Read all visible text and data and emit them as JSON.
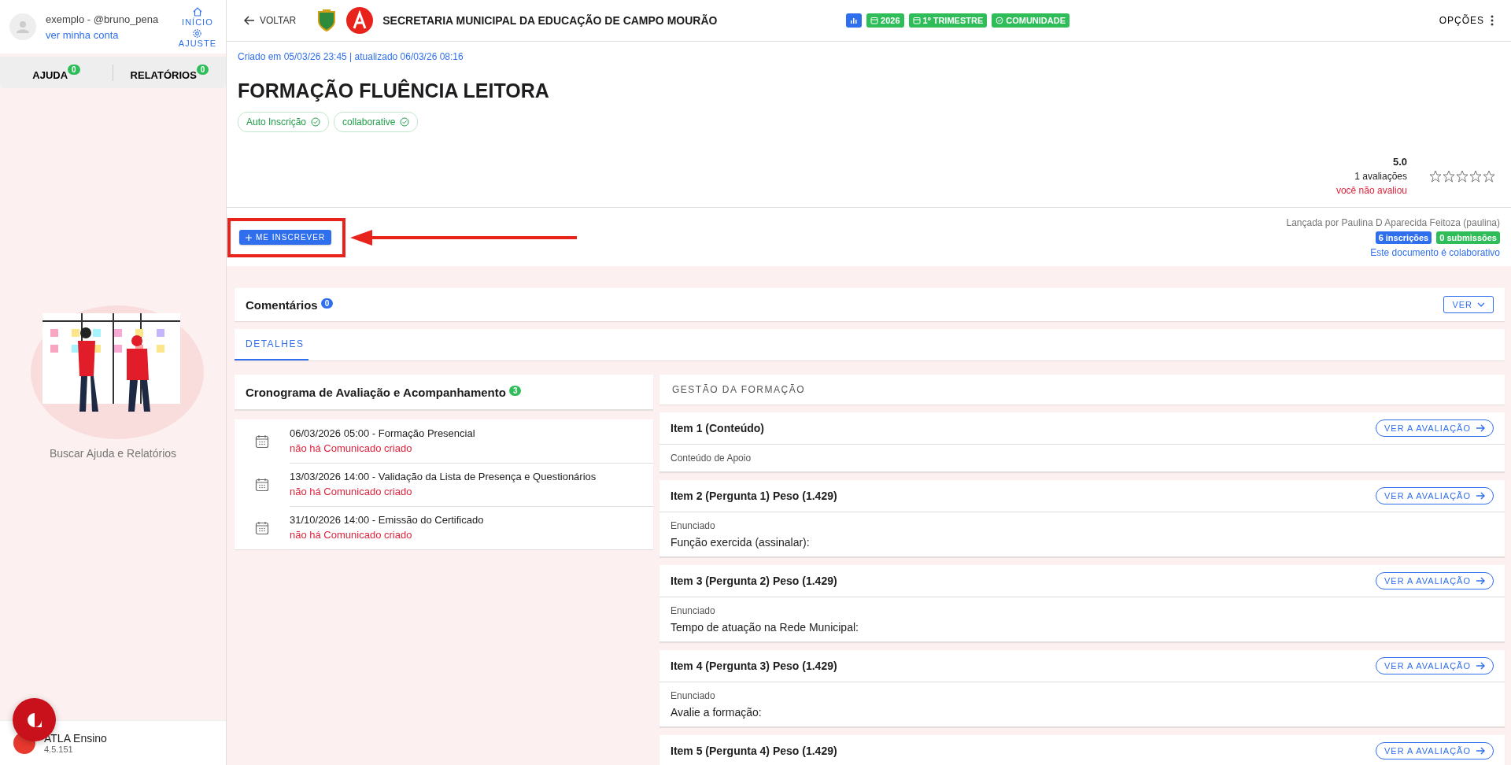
{
  "sidebar": {
    "user_name": "exemplo - @bruno_pena",
    "account_link": "ver minha conta",
    "nav": [
      {
        "kind": "home",
        "label": "INÍCIO"
      },
      {
        "kind": "settings",
        "label": "AJUSTE"
      }
    ],
    "tabs": [
      {
        "label": "AJUDA",
        "count": "0"
      },
      {
        "label": "RELATÓRIOS",
        "count": "0"
      }
    ],
    "empty_text": "Buscar Ajuda e Relatórios",
    "footer": {
      "app_name": "ATLA Ensino",
      "version": "4.5.151"
    }
  },
  "topbar": {
    "back": "VOLTAR",
    "title": "SECRETARIA MUNICIPAL DA EDUCAÇÃO DE CAMPO MOURÃO",
    "badges": [
      {
        "kind": "chart",
        "color": "#2f6fed"
      },
      {
        "kind": "calendar",
        "label": "2026",
        "color": "#2ebd59"
      },
      {
        "kind": "calendar",
        "label": "1º TRIMESTRE",
        "color": "#2ebd59"
      },
      {
        "kind": "check",
        "label": "COMUNIDADE",
        "color": "#2ebd59"
      }
    ],
    "options": "OPÇÕES"
  },
  "document": {
    "meta": "Criado em 05/03/26 23:45 | atualizado 06/03/26 08:16",
    "title": "FORMAÇÃO FLUÊNCIA LEITORA",
    "tags": [
      "Auto Inscrição",
      "collaborative"
    ],
    "rating": {
      "score": "5.0",
      "count": "1 avaliações",
      "note": "você não avaliou",
      "stars": 0
    },
    "enroll_button": "ME INSCREVER",
    "author": "Lançada por Paulina D Aparecida Feitoza (paulina)",
    "stats": [
      {
        "label": "6 inscrições",
        "color": "#2f6fed"
      },
      {
        "label": "0 submissões",
        "color": "#2ebd59"
      }
    ],
    "collab_link": "Este documento é colaborativo"
  },
  "comments": {
    "title": "Comentários",
    "count": "0",
    "button": "VER"
  },
  "tabs": [
    {
      "label": "DETALHES",
      "selected": true
    }
  ],
  "schedule": {
    "title": "Cronograma de Avaliação e Acompanhamento",
    "count": "3",
    "items": [
      {
        "date": "06/03/2026 05:00 - Formação Presencial",
        "status": "não há Comunicado criado"
      },
      {
        "date": "13/03/2026 14:00 - Validação da Lista de Presença e Questionários",
        "status": "não há Comunicado criado"
      },
      {
        "date": "31/10/2026 14:00 - Emissão do Certificado",
        "status": "não há Comunicado criado"
      }
    ]
  },
  "management": {
    "title": "GESTÃO DA FORMAÇÃO",
    "items": [
      {
        "title": "Item 1 (Conteúdo)",
        "button": "VER A AVALIAÇÃO",
        "label": "Conteúdo de Apoio"
      },
      {
        "title": "Item 2 (Pergunta 1) Peso (1.429)",
        "button": "VER A AVALIAÇÃO",
        "label": "Enunciado",
        "text": "Função exercida (assinalar):"
      },
      {
        "title": "Item 3 (Pergunta 2) Peso (1.429)",
        "button": "VER A AVALIAÇÃO",
        "label": "Enunciado",
        "text": "Tempo de atuação na Rede Municipal:"
      },
      {
        "title": "Item 4 (Pergunta 3) Peso (1.429)",
        "button": "VER A AVALIAÇÃO",
        "label": "Enunciado",
        "text": "Avalie a formação:"
      },
      {
        "title": "Item 5 (Pergunta 4) Peso (1.429)",
        "button": "VER A AVALIAÇÃO"
      }
    ]
  }
}
